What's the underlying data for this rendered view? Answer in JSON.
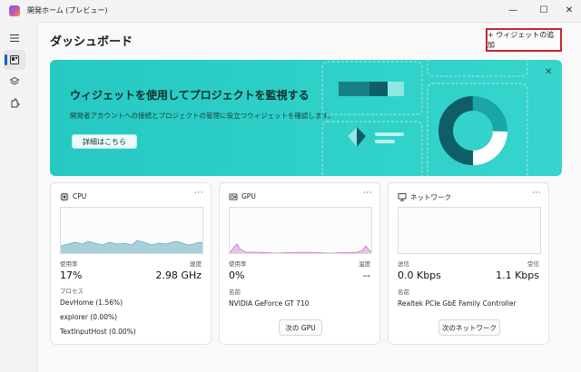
{
  "window": {
    "title": "開発ホーム (プレビュー)",
    "minimize": "—",
    "maximize": "☐",
    "close": "✕"
  },
  "rail": {
    "items": [
      {
        "icon": "hamburger-icon"
      },
      {
        "icon": "dashboard-icon",
        "active": true
      },
      {
        "icon": "layers-icon"
      },
      {
        "icon": "extensions-icon"
      }
    ]
  },
  "page": {
    "title": "ダッシュボード",
    "add_widget": "+ ウィジェットの追加"
  },
  "banner": {
    "title": "ウィジェットを使用してプロジェクトを監視する",
    "subtitle": "開発者アカウントへの接続とプロジェクトの管理に役立つウィジェットを確認します。",
    "button": "詳細はこちら",
    "close": "✕"
  },
  "widgets": {
    "cpu": {
      "title": "CPU",
      "more": "···",
      "usage_label": "使用率",
      "speed_label": "速度",
      "usage_value": "17%",
      "speed_value": "2.98 GHz",
      "process_label": "プロセス",
      "processes": [
        "DevHome (1.56%)",
        "explorer (0.00%)",
        "TextInputHost (0.00%)"
      ],
      "chart_color": "#a8d0db",
      "chart_line": "#6aa8bb"
    },
    "gpu": {
      "title": "GPU",
      "more": "···",
      "usage_label": "使用率",
      "temp_label": "温度",
      "usage_value": "0%",
      "temp_value": "--",
      "name_label": "名前",
      "name_value": "NVIDIA GeForce GT 710",
      "next_button": "次の GPU",
      "chart_color": "#e8c3e8",
      "chart_line": "#c47cc4"
    },
    "network": {
      "title": "ネットワーク",
      "more": "···",
      "send_label": "送信",
      "recv_label": "受信",
      "send_value": "0.0 Kbps",
      "recv_value": "1.1 Kbps",
      "name_label": "名前",
      "name_value": "Realtek PCIe GbE Family Controller",
      "next_button": "次のネットワーク"
    }
  },
  "colors": {
    "accent": "#0067c0",
    "banner": "#2fd1c9",
    "highlight_border": "#c4262e"
  }
}
